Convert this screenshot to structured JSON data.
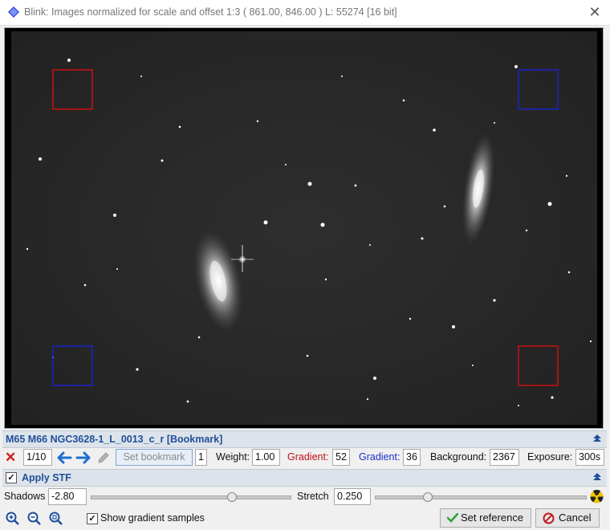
{
  "window": {
    "title": "Blink: Images normalized for scale and offset 1:3 (  861.00,  846.00 )  L: 55274 [16 bit]",
    "close_icon": "close-icon"
  },
  "file_bar": {
    "label": "M65 M66 NGC3628-1_L_0013_c_r [Bookmark]"
  },
  "toolbar": {
    "counter": "1/10",
    "set_bookmark_label": "Set bookmark",
    "bookmark_value": "1",
    "weight_label": "Weight:",
    "weight_value": "1.00",
    "gradient_red_label": "Gradient:",
    "gradient_red_value": "52",
    "gradient_blue_label": "Gradient:",
    "gradient_blue_value": "36",
    "background_label": "Background:",
    "background_value": "2367",
    "exposure_label": "Exposure:",
    "exposure_value": "300s"
  },
  "stf_bar": {
    "label": "Apply STF",
    "checked": true
  },
  "stf": {
    "shadows_label": "Shadows",
    "shadows_value": "-2.80",
    "shadows_slider_fraction": 0.71,
    "stretch_label": "Stretch",
    "stretch_value": "0.250",
    "stretch_slider_fraction": 0.25
  },
  "bottom": {
    "show_gradient_label": "Show gradient samples",
    "show_gradient_checked": true,
    "set_reference_label": "Set reference",
    "cancel_label": "Cancel"
  },
  "colors": {
    "accent_blue": "#1f4f9a",
    "gradient_red": "#c0101a",
    "gradient_blue": "#1a2fc8",
    "sample_red": "#cc1010",
    "sample_blue": "#1a22cc"
  }
}
